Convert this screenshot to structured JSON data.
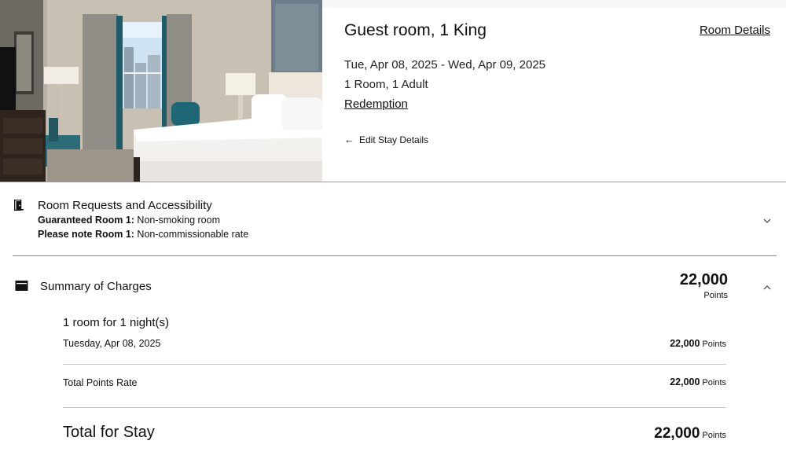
{
  "room": {
    "title": "Guest room, 1 King",
    "details_link": "Room Details",
    "dates": "Tue, Apr 08, 2025 - Wed, Apr 09, 2025",
    "occupancy": "1 Room, 1 Adult",
    "rate_type": "Redemption",
    "edit_stay": "Edit Stay Details"
  },
  "requests": {
    "title": "Room Requests and Accessibility",
    "lines": [
      {
        "label": "Guaranteed Room 1:",
        "value": " Non-smoking room"
      },
      {
        "label": "Please note Room 1:",
        "value": " Non-commissionable rate"
      }
    ]
  },
  "summary": {
    "title": "Summary of Charges",
    "total": "22,000",
    "total_unit": "Points",
    "nights_label": "1 room for 1 night(s)",
    "night_date": "Tuesday, Apr 08, 2025",
    "night_amount": "22,000",
    "night_unit": "Points",
    "rate_label": "Total Points Rate",
    "rate_amount": "22,000",
    "rate_unit": "Points",
    "stay_label": "Total for Stay",
    "stay_amount": "22,000",
    "stay_unit": "Points"
  },
  "icons": {
    "edit_arrow": "arrow-left-icon",
    "requests": "door-icon",
    "summary": "wallet-icon",
    "collapse": "chevron-up-icon",
    "expand": "chevron-down-icon"
  }
}
